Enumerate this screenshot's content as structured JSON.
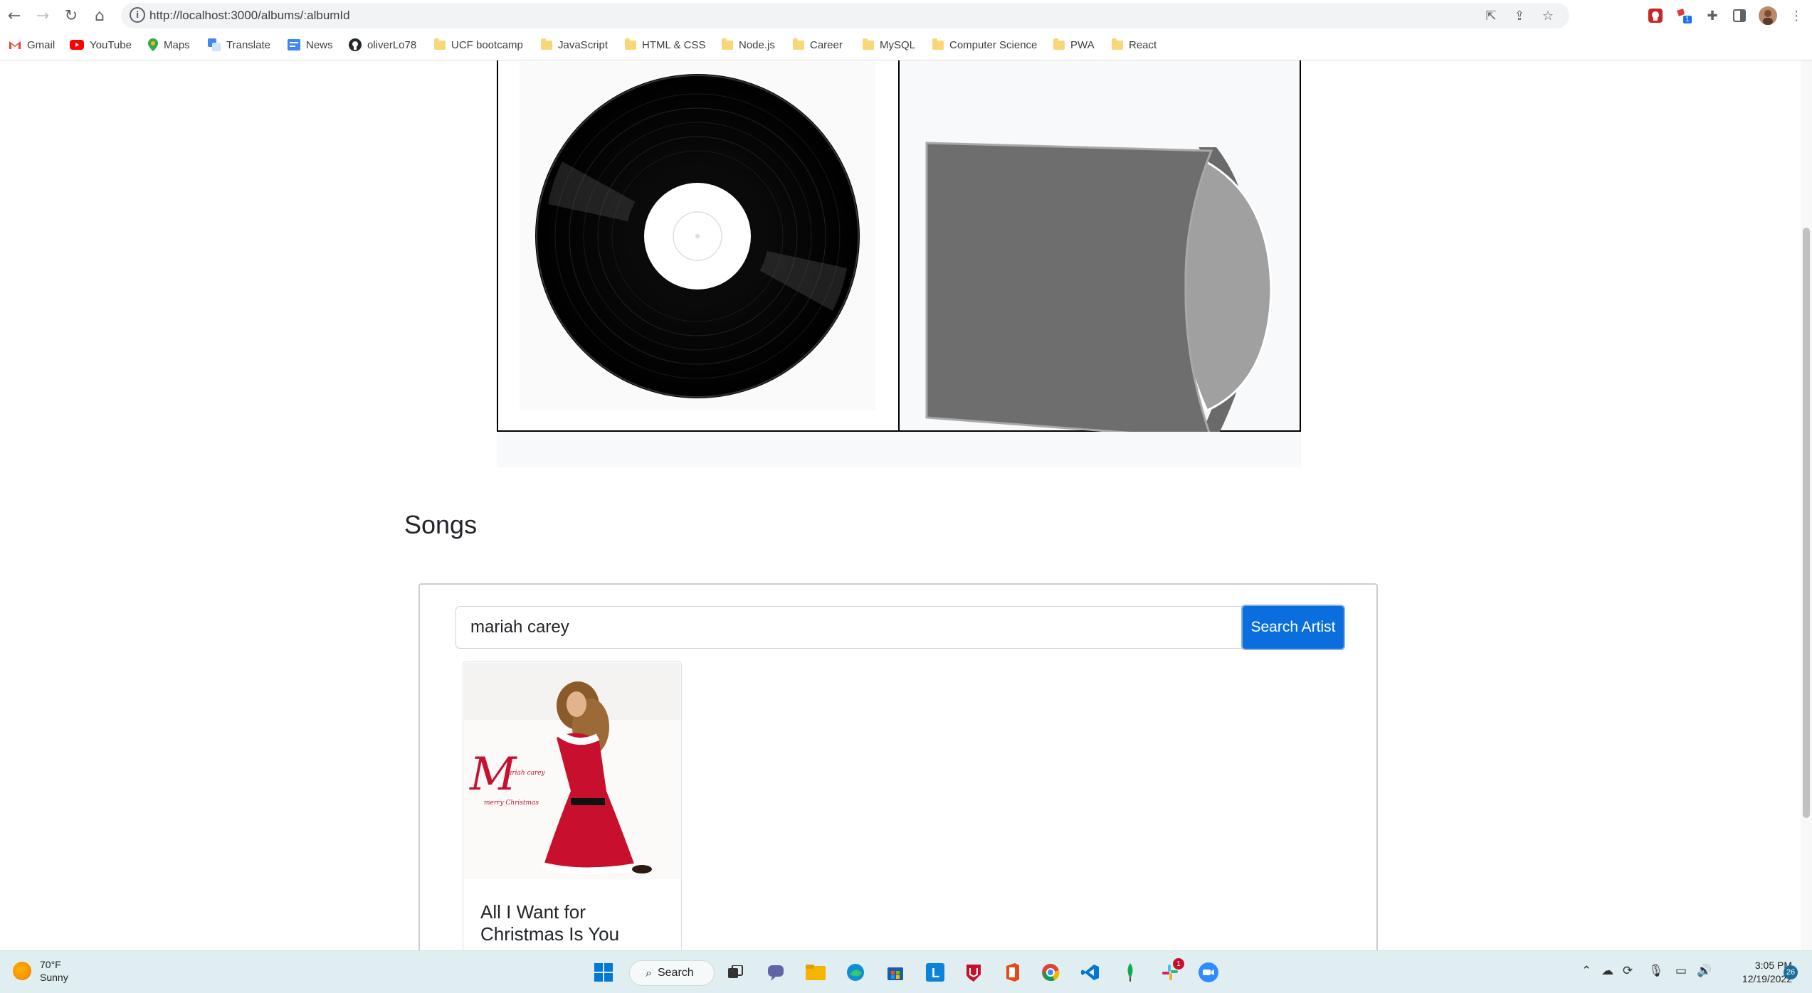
{
  "browser": {
    "url": "http://localhost:3000/albums/:albumId",
    "bookmarks": [
      {
        "label": "Gmail",
        "icon": "gmail-icon"
      },
      {
        "label": "YouTube",
        "icon": "youtube-icon"
      },
      {
        "label": "Maps",
        "icon": "maps-icon"
      },
      {
        "label": "Translate",
        "icon": "translate-icon"
      },
      {
        "label": "News",
        "icon": "news-icon"
      },
      {
        "label": "oliverLo78",
        "icon": "github-icon"
      },
      {
        "label": "UCF bootcamp",
        "icon": "folder-icon"
      },
      {
        "label": "JavaScript",
        "icon": "folder-icon"
      },
      {
        "label": "HTML & CSS",
        "icon": "folder-icon"
      },
      {
        "label": "Node.js",
        "icon": "folder-icon"
      },
      {
        "label": "Career",
        "icon": "folder-icon"
      },
      {
        "label": "MySQL",
        "icon": "folder-icon"
      },
      {
        "label": "Computer Science",
        "icon": "folder-icon"
      },
      {
        "label": "PWA",
        "icon": "folder-icon"
      },
      {
        "label": "React",
        "icon": "folder-icon"
      }
    ],
    "extension_badge": "1"
  },
  "page": {
    "songs_heading": "Songs",
    "search": {
      "value": "mariah carey",
      "button_label": "Search Artist"
    },
    "results": [
      {
        "title": "All I Want for Christmas Is You",
        "cover_text_big": "M",
        "cover_text_line1": "ariah carey",
        "cover_text_line2": "merry Christmas"
      }
    ]
  },
  "taskbar": {
    "weather_temp": "70°F",
    "weather_desc": "Sunny",
    "search_label": "Search",
    "slack_badge": "1",
    "time": "3:05 PM",
    "date": "12/19/2022",
    "notification_count": "26"
  },
  "colors": {
    "primary_button": "#0b6ede",
    "taskbar": "#e1eef1",
    "sleeve": "#6e6e6e",
    "disc_edge": "#a0a0a0"
  }
}
